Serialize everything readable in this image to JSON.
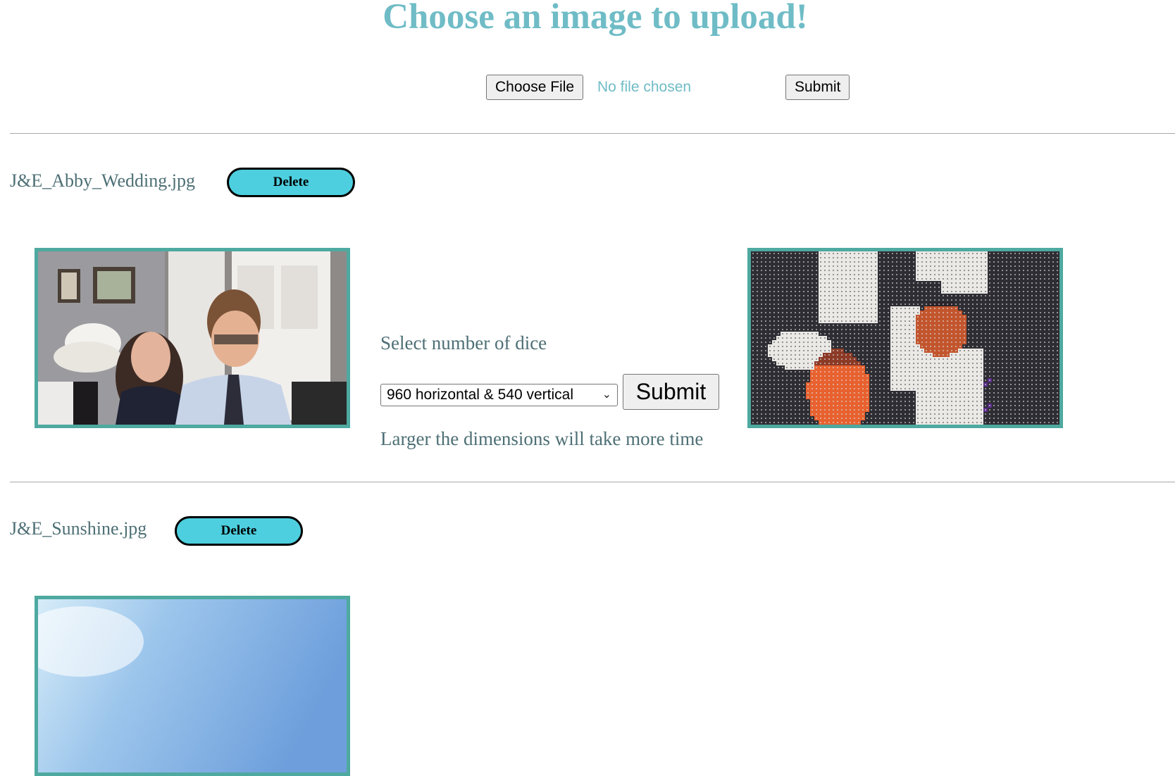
{
  "header": {
    "title": "Choose an image to upload!"
  },
  "upload": {
    "choose_file_label": "Choose File",
    "file_status": "No file chosen",
    "submit_label": "Submit"
  },
  "images": [
    {
      "filename": "J&E_Abby_Wedding.jpg",
      "delete_label": "Delete",
      "dice_prompt": "Select number of dice",
      "dice_selected": "960 horizontal & 540 vertical",
      "submit_label": "Submit",
      "hint": "Larger the dimensions will take more time"
    },
    {
      "filename": "J&E_Sunshine.jpg",
      "delete_label": "Delete"
    }
  ],
  "colors": {
    "accent": "#6fbcc6",
    "text_muted": "#4d6f75",
    "delete_button": "#4dcfdf",
    "image_border": "#4ea9a0"
  }
}
